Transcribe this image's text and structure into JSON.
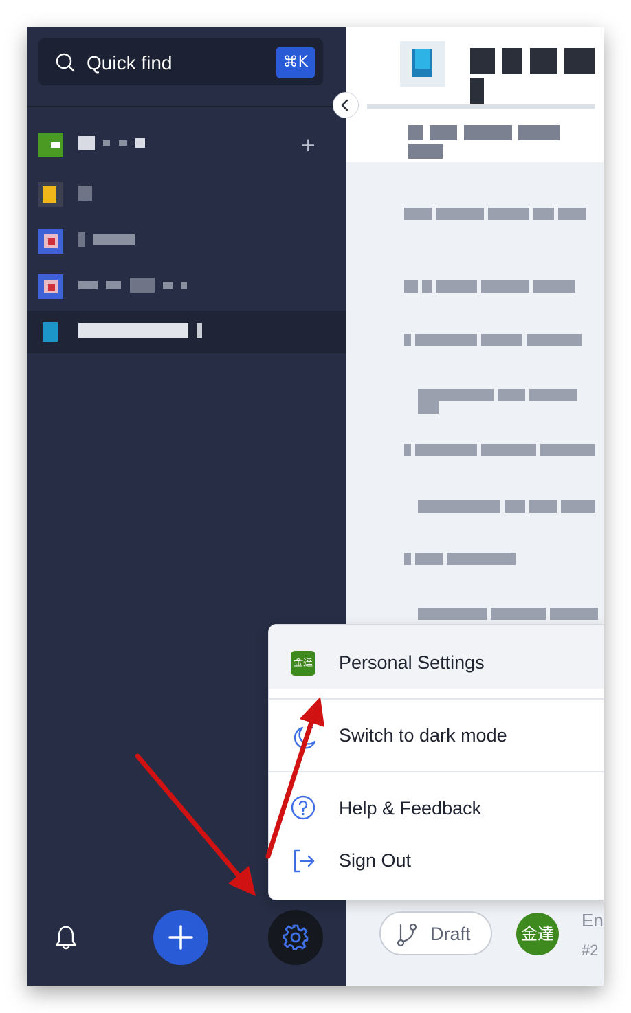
{
  "search": {
    "label": "Quick find",
    "shortcut": "⌘K"
  },
  "menu": {
    "personal_settings": "Personal Settings",
    "personal_avatar_text": "金達",
    "dark_mode": "Switch to dark mode",
    "help": "Help & Feedback",
    "sign_out": "Sign Out"
  },
  "footer": {
    "draft_label": "Draft",
    "user_avatar_text": "金達",
    "meta_line1": "En",
    "meta_line2": "#2"
  },
  "colors": {
    "sidebar_bg": "#262d44",
    "accent": "#2a5bd7",
    "annotation_arrow": "#d01212",
    "avatar_green": "#3f8a1f"
  },
  "icons": [
    "search-icon",
    "plus-icon",
    "bell-icon",
    "add-icon",
    "gear-icon",
    "chevron-left-icon",
    "moon-icon",
    "question-circle-icon",
    "sign-out-icon",
    "branch-icon"
  ]
}
